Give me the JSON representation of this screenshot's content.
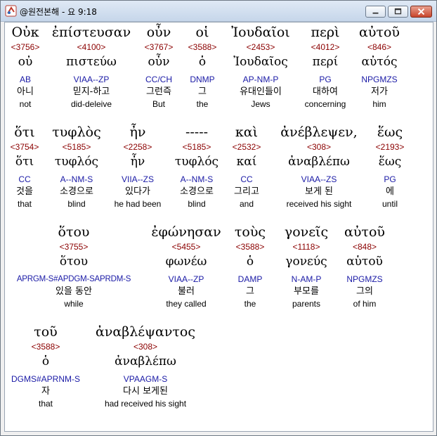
{
  "window": {
    "title": "@원전본해 - 요 9:18"
  },
  "rows": [
    [
      {
        "greek": "Οὐκ",
        "strong": "<3756>",
        "lemma": "οὐ",
        "parse": "AB",
        "korean": "아니",
        "english": "not"
      },
      {
        "greek": "ἐπίστευσαν",
        "strong": "<4100>",
        "lemma": "πιστεύω",
        "parse": "VIAA--ZP",
        "korean": "믿지-하고",
        "english": "did-deleive"
      },
      {
        "greek": "οὖν",
        "strong": "<3767>",
        "lemma": "οὖν",
        "parse": "CC/CH",
        "korean": "그런즉",
        "english": "But"
      },
      {
        "greek": "οἱ",
        "strong": "<3588>",
        "lemma": "ὁ",
        "parse": "DNMP",
        "korean": "그",
        "english": "the"
      },
      {
        "greek": "Ἰουδαῖοι",
        "strong": "<2453>",
        "lemma": "Ἰουδαῖος",
        "parse": "AP-NM-P",
        "korean": "유대인들이",
        "english": "Jews"
      },
      {
        "greek": "περὶ",
        "strong": "<4012>",
        "lemma": "περί",
        "parse": "PG",
        "korean": "대하여",
        "english": "concerning"
      },
      {
        "greek": "αὐτοῦ",
        "strong": "<846>",
        "lemma": "αὐτός",
        "parse": "NPGMZS",
        "korean": "저가",
        "english": "him"
      }
    ],
    [
      {
        "greek": "ὅτι",
        "strong": "<3754>",
        "lemma": "ὅτι",
        "parse": "CC",
        "korean": "것을",
        "english": "that"
      },
      {
        "greek": "τυφλὸς",
        "strong": "<5185>",
        "lemma": "τυφλός",
        "parse": "A--NM-S",
        "korean": "소경으로",
        "english": "blind"
      },
      {
        "greek": "ἦν",
        "strong": "<2258>",
        "lemma": "ἦν",
        "parse": "VIIA--ZS",
        "korean": "있다가",
        "english": "he had been"
      },
      {
        "greek": "-----",
        "strong": "<5185>",
        "lemma": "τυφλός",
        "parse": "A--NM-S",
        "korean": "소경으로",
        "english": "blind"
      },
      {
        "greek": "καὶ",
        "strong": "<2532>",
        "lemma": "καί",
        "parse": "CC",
        "korean": "그리고",
        "english": "and"
      },
      {
        "greek": "ἀνέβλεψεν,",
        "strong": "<308>",
        "lemma": "ἀναβλέπω",
        "parse": "VIAA--ZS",
        "korean": "보게 된",
        "english": "received his sight"
      },
      {
        "greek": "ἕως",
        "strong": "<2193>",
        "lemma": "ἕως",
        "parse": "PG",
        "korean": "에",
        "english": "until"
      }
    ],
    [
      {
        "greek": "ὅτου",
        "strong": "<3755>",
        "lemma": "ὅτου",
        "parse": "APRGM-S#APDGM-SAPRDM-S",
        "korean": "있을 동안",
        "english": "while"
      },
      {
        "greek": "ἐφώνησαν",
        "strong": "<5455>",
        "lemma": "φωνέω",
        "parse": "VIAA--ZP",
        "korean": "불러",
        "english": "they called"
      },
      {
        "greek": "τοὺς",
        "strong": "<3588>",
        "lemma": "ὁ",
        "parse": "DAMP",
        "korean": "그",
        "english": "the"
      },
      {
        "greek": "γονεῖς",
        "strong": "<1118>",
        "lemma": "γονεύς",
        "parse": "N-AM-P",
        "korean": "부모를",
        "english": "parents"
      },
      {
        "greek": "αὐτοῦ",
        "strong": "<848>",
        "lemma": "αὑτοῦ",
        "parse": "NPGMZS",
        "korean": "그의",
        "english": "of him"
      }
    ],
    [
      {
        "greek": "τοῦ",
        "strong": "<3588>",
        "lemma": "ὁ",
        "parse": "DGMS#APRNM-S",
        "korean": "자",
        "english": "that"
      },
      {
        "greek": "ἀναβλέψαντος",
        "strong": "<308>",
        "lemma": "ἀναβλέπω",
        "parse": "VPAAGM-S",
        "korean": "다시 보게된",
        "english": "had received his sight"
      }
    ]
  ]
}
